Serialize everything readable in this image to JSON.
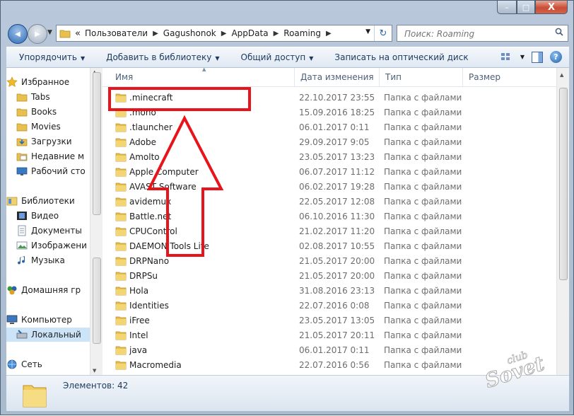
{
  "window": {
    "title_buttons": {
      "minimize": "–",
      "maximize": "□",
      "close": "X"
    }
  },
  "nav_buttons": {
    "back": "◀",
    "forward": "▶"
  },
  "address": {
    "prefix": "«",
    "crumbs": [
      "Пользователи",
      "Gagushonok",
      "AppData",
      "Roaming"
    ],
    "refresh": "↻"
  },
  "search": {
    "placeholder": "Поиск: Roaming"
  },
  "toolbar": {
    "organize": "Упорядочить",
    "add_library": "Добавить в библиотеку",
    "share": "Общий доступ",
    "burn": "Записать на оптический диск",
    "help": "?"
  },
  "sidebar": {
    "favorites": "Избранное",
    "tabs": "Tabs",
    "books": "Books",
    "movies": "Movies",
    "downloads": "Загрузки",
    "recent": "Недавние м",
    "desktop": "Рабочий сто",
    "libraries": "Библиотеки",
    "video": "Видео",
    "documents": "Документы",
    "pictures": "Изображени",
    "music": "Музыка",
    "homegroup": "Домашняя гр",
    "computer": "Компьютер",
    "local": "Локальный",
    "network": "Сеть"
  },
  "columns": {
    "name": "Имя",
    "date": "Дата изменения",
    "type": "Тип",
    "size": "Размер"
  },
  "files": [
    {
      "name": ".minecraft",
      "date": "22.10.2017 23:55",
      "type": "Папка с файлами"
    },
    {
      "name": ".mono",
      "date": "15.09.2016 18:25",
      "type": "Папка с файлами"
    },
    {
      "name": ".tlauncher",
      "date": "06.01.2017 0:11",
      "type": "Папка с файлами"
    },
    {
      "name": "Adobe",
      "date": "29.09.2017 9:05",
      "type": "Папка с файлами"
    },
    {
      "name": "Amolto",
      "date": "23.05.2017 13:23",
      "type": "Папка с файлами"
    },
    {
      "name": "Apple Computer",
      "date": "06.07.2017 11:12",
      "type": "Папка с файлами"
    },
    {
      "name": "AVAST Software",
      "date": "06.02.2017 19:28",
      "type": "Папка с файлами"
    },
    {
      "name": "avidemux",
      "date": "22.05.2017 12:08",
      "type": "Папка с файлами"
    },
    {
      "name": "Battle.net",
      "date": "06.10.2016 11:30",
      "type": "Папка с файлами"
    },
    {
      "name": "CPUControl",
      "date": "21.02.2017 11:20",
      "type": "Папка с файлами"
    },
    {
      "name": "DAEMON Tools Lite",
      "date": "02.08.2017 10:55",
      "type": "Папка с файлами"
    },
    {
      "name": "DRPNano",
      "date": "21.05.2017 20:00",
      "type": "Папка с файлами"
    },
    {
      "name": "DRPSu",
      "date": "21.05.2017 20:00",
      "type": "Папка с файлами"
    },
    {
      "name": "Hola",
      "date": "31.08.2016 23:13",
      "type": "Папка с файлами"
    },
    {
      "name": "Identities",
      "date": "22.07.2016 0:08",
      "type": "Папка с файлами"
    },
    {
      "name": "iFree",
      "date": "23.05.2017 13:05",
      "type": "Папка с файлами"
    },
    {
      "name": "Intel",
      "date": "21.05.2017 20:11",
      "type": "Папка с файлами"
    },
    {
      "name": "java",
      "date": "06.01.2017 0:11",
      "type": "Папка с файлами"
    },
    {
      "name": "Macromedia",
      "date": "22.07.2016 0:56",
      "type": "Папка с файлами"
    }
  ],
  "status": {
    "count_text": "Элементов: 42"
  },
  "watermark": {
    "text": "Sovet",
    "sub": "club"
  },
  "colors": {
    "annotation": "#e8141b",
    "toolbar_text": "#1e395b"
  }
}
